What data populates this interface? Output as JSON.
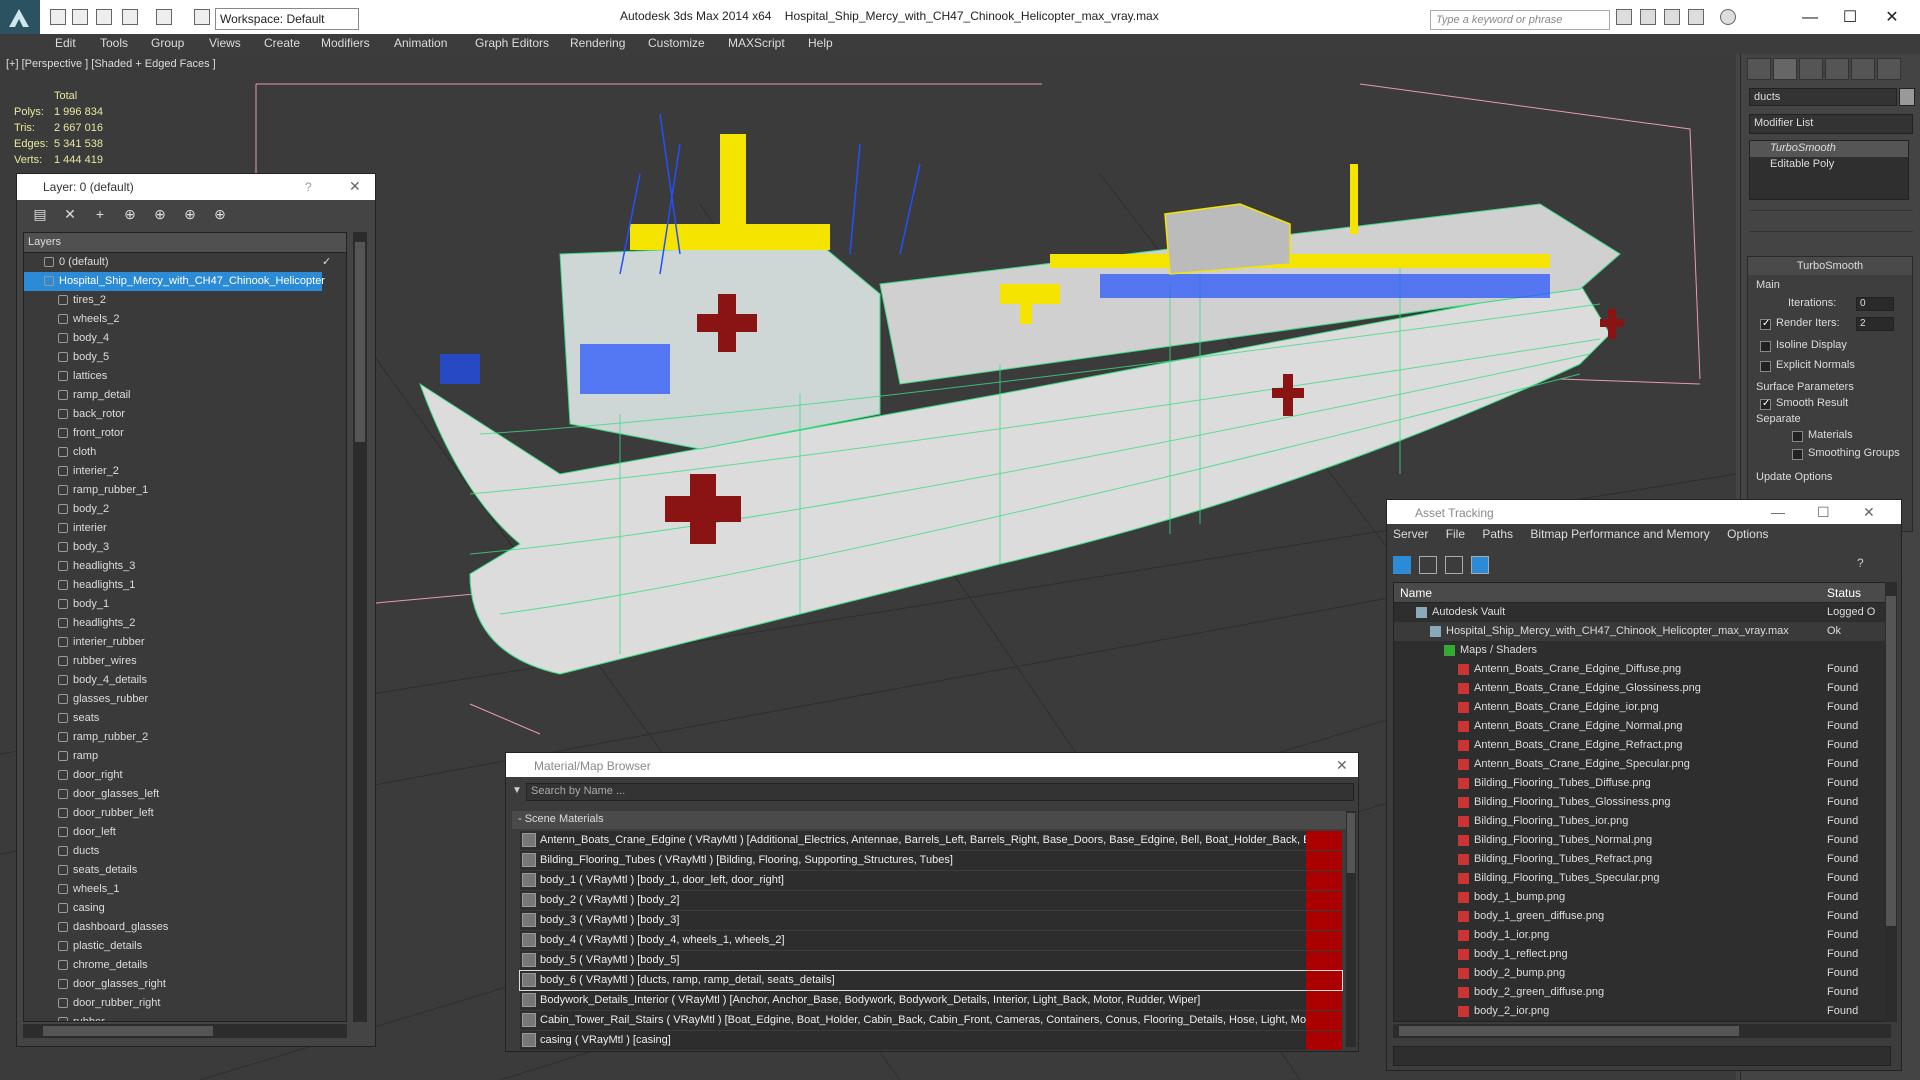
{
  "titlebar": {
    "app": "Autodesk 3ds Max  2014 x64",
    "file": "Hospital_Ship_Mercy_with_CH47_Chinook_Helicopter_max_vray.max",
    "workspace": "Workspace: Default",
    "search_placeholder": "Type a keyword or phrase"
  },
  "menu": [
    "Edit",
    "Tools",
    "Group",
    "Views",
    "Create",
    "Modifiers",
    "Animation",
    "Graph Editors",
    "Rendering",
    "Customize",
    "MAXScript",
    "Help"
  ],
  "viewport": {
    "label": "[+] [Perspective ] [Shaded + Edged Faces ]",
    "stats": {
      "total_label": "Total",
      "polys_label": "Polys:",
      "polys": "1 996 834",
      "tris_label": "Tris:",
      "tris": "2 667 016",
      "edges_label": "Edges:",
      "edges": "5 341 538",
      "verts_label": "Verts:",
      "verts": "1 444 419"
    }
  },
  "command_panel": {
    "object_name": "ducts",
    "modifier_list": "Modifier List",
    "stack": [
      "TurboSmooth",
      "Editable Poly"
    ],
    "rollout_title": "TurboSmooth",
    "main_label": "Main",
    "iterations_label": "Iterations:",
    "iterations": "0",
    "render_iters_label": "Render Iters:",
    "render_iters": "2",
    "isoline": "Isoline Display",
    "explicit_normals": "Explicit Normals",
    "surface_params": "Surface Parameters",
    "smooth_result": "Smooth Result",
    "separate": "Separate",
    "materials": "Materials",
    "smoothing_groups": "Smoothing Groups",
    "update_options": "Update Options"
  },
  "layer_window": {
    "title": "Layer: 0 (default)",
    "column": "Layers",
    "layers": [
      "0 (default)",
      "Hospital_Ship_Mercy_with_CH47_Chinook_Helicopter"
    ],
    "objects": [
      "tires_2",
      "wheels_2",
      "body_4",
      "body_5",
      "lattices",
      "ramp_detail",
      "back_rotor",
      "front_rotor",
      "cloth",
      "interier_2",
      "ramp_rubber_1",
      "body_2",
      "interier",
      "body_3",
      "headlights_3",
      "headlights_1",
      "body_1",
      "headlights_2",
      "interier_rubber",
      "rubber_wires",
      "body_4_details",
      "glasses_rubber",
      "seats",
      "ramp_rubber_2",
      "ramp",
      "door_right",
      "door_glasses_left",
      "door_rubber_left",
      "door_left",
      "ducts",
      "seats_details",
      "wheels_1",
      "casing",
      "dashboard_glasses",
      "plastic_details",
      "chrome_details",
      "door_glasses_right",
      "door_rubber_right",
      "rubber"
    ]
  },
  "asset_tracking": {
    "title": "Asset Tracking",
    "menu": [
      "Server",
      "File",
      "Paths",
      "Bitmap Performance and Memory",
      "Options"
    ],
    "col_name": "Name",
    "col_status": "Status",
    "rows": [
      {
        "name": "Autodesk Vault",
        "status": "Logged O",
        "indent": 0
      },
      {
        "name": "Hospital_Ship_Mercy_with_CH47_Chinook_Helicopter_max_vray.max",
        "status": "Ok",
        "indent": 1
      },
      {
        "name": "Maps / Shaders",
        "status": "",
        "indent": 2
      },
      {
        "name": "Antenn_Boats_Crane_Edgine_Diffuse.png",
        "status": "Found",
        "indent": 3
      },
      {
        "name": "Antenn_Boats_Crane_Edgine_Glossiness.png",
        "status": "Found",
        "indent": 3
      },
      {
        "name": "Antenn_Boats_Crane_Edgine_ior.png",
        "status": "Found",
        "indent": 3
      },
      {
        "name": "Antenn_Boats_Crane_Edgine_Normal.png",
        "status": "Found",
        "indent": 3
      },
      {
        "name": "Antenn_Boats_Crane_Edgine_Refract.png",
        "status": "Found",
        "indent": 3
      },
      {
        "name": "Antenn_Boats_Crane_Edgine_Specular.png",
        "status": "Found",
        "indent": 3
      },
      {
        "name": "Bilding_Flooring_Tubes_Diffuse.png",
        "status": "Found",
        "indent": 3
      },
      {
        "name": "Bilding_Flooring_Tubes_Glossiness.png",
        "status": "Found",
        "indent": 3
      },
      {
        "name": "Bilding_Flooring_Tubes_ior.png",
        "status": "Found",
        "indent": 3
      },
      {
        "name": "Bilding_Flooring_Tubes_Normal.png",
        "status": "Found",
        "indent": 3
      },
      {
        "name": "Bilding_Flooring_Tubes_Refract.png",
        "status": "Found",
        "indent": 3
      },
      {
        "name": "Bilding_Flooring_Tubes_Specular.png",
        "status": "Found",
        "indent": 3
      },
      {
        "name": "body_1_bump.png",
        "status": "Found",
        "indent": 3
      },
      {
        "name": "body_1_green_diffuse.png",
        "status": "Found",
        "indent": 3
      },
      {
        "name": "body_1_ior.png",
        "status": "Found",
        "indent": 3
      },
      {
        "name": "body_1_reflect.png",
        "status": "Found",
        "indent": 3
      },
      {
        "name": "body_2_bump.png",
        "status": "Found",
        "indent": 3
      },
      {
        "name": "body_2_green_diffuse.png",
        "status": "Found",
        "indent": 3
      },
      {
        "name": "body_2_ior.png",
        "status": "Found",
        "indent": 3
      }
    ]
  },
  "material_browser": {
    "title": "Material/Map Browser",
    "search_placeholder": "Search by Name ...",
    "group": "- Scene Materials",
    "materials": [
      "Antenn_Boats_Crane_Edgine  ( VRayMtl )  [Additional_Electrics, Antennae, Barrels_Left, Barrels_Right, Base_Doors, Base_Edgine, Bell, Boat_Holder_Back, B...",
      "Bilding_Flooring_Tubes  ( VRayMtl )  [Bilding, Flooring, Supporting_Structures, Tubes]",
      "body_1  ( VRayMtl )  [body_1, door_left, door_right]",
      "body_2  ( VRayMtl )  [body_2]",
      "body_3  ( VRayMtl )  [body_3]",
      "body_4  ( VRayMtl )  [body_4, wheels_1, wheels_2]",
      "body_5  ( VRayMtl )  [body_5]",
      "body_6  ( VRayMtl )  [ducts, ramp, ramp_detail, seats_details]",
      "Bodywork_Details_Interior  ( VRayMtl )  [Anchor, Anchor_Base, Bodywork, Bodywork_Details, Interior, Light_Back, Motor, Rudder, Wiper]",
      "Cabin_Tower_Rail_Stairs  ( VRayMtl )  [Boat_Edgine, Boat_Holder, Cabin_Back, Cabin_Front, Cameras, Containers, Conus, Flooring_Details, Hose, Light, Mot...",
      "casing  ( VRayMtl )  [casing]"
    ]
  },
  "colors": {
    "accent": "#2b8bd6",
    "wire_green": "#3ddc84",
    "wire_yellow": "#f5e400",
    "wire_blue": "#2050ff",
    "hull_red": "#a01818"
  }
}
